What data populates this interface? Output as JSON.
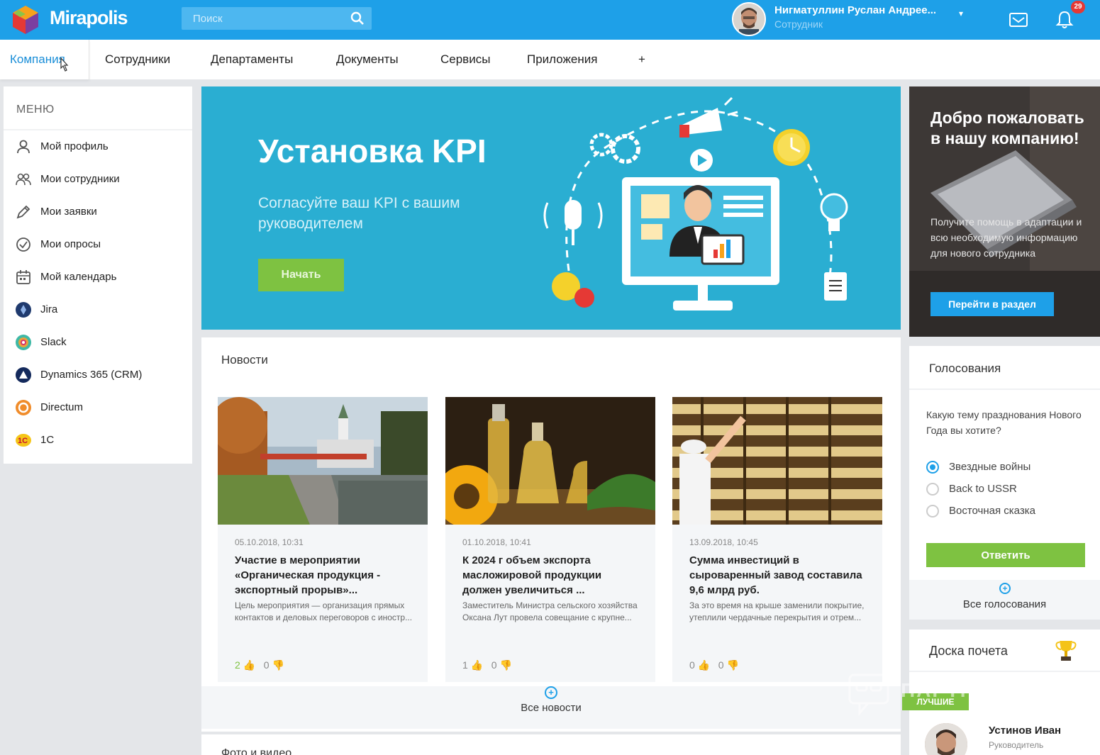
{
  "header": {
    "logo_text": "Mirapolis",
    "search_placeholder": "Поиск",
    "user_name": "Нигматуллин Руслан Андрее...",
    "user_role": "Сотрудник",
    "notifications_count": "29"
  },
  "nav": {
    "tabs": [
      "Компания",
      "Сотрудники",
      "Департаменты",
      "Документы",
      "Сервисы",
      "Приложения",
      "+"
    ],
    "active": "Компания"
  },
  "sidebar": {
    "title": "МЕНЮ",
    "items": [
      {
        "label": "Мой профиль",
        "icon": "user-icon"
      },
      {
        "label": "Мои сотрудники",
        "icon": "users-icon"
      },
      {
        "label": "Мои заявки",
        "icon": "pencil-icon"
      },
      {
        "label": "Мои опросы",
        "icon": "check-circle-icon"
      },
      {
        "label": "Мой календарь",
        "icon": "calendar-icon"
      },
      {
        "label": "Jira",
        "icon": "jira-icon"
      },
      {
        "label": "Slack",
        "icon": "slack-icon"
      },
      {
        "label": "Dynamics 365 (CRM)",
        "icon": "dynamics-icon"
      },
      {
        "label": "Directum",
        "icon": "directum-icon"
      },
      {
        "label": "1C",
        "icon": "1c-icon"
      }
    ]
  },
  "banner": {
    "title": "Установка KPI",
    "subtitle": "Согласуйте ваш KPI с вашим руководителем",
    "button": "Начать"
  },
  "welcome": {
    "title": "Добро пожаловать в нашу компанию!",
    "text": "Получите помощь в адаптации и всю необходимую информацию для нового сотрудника",
    "button": "Перейти в раздел"
  },
  "news": {
    "title": "Новости",
    "items": [
      {
        "date": "05.10.2018, 10:31",
        "headline": "Участие в мероприятии «Органическая продукция - экспортный прорыв»...",
        "text": "Цель мероприятия — организация прямых контактов и деловых переговоров с иностр...",
        "likes": "2",
        "dislikes": "0"
      },
      {
        "date": "01.10.2018, 10:41",
        "headline": "К 2024 г объем экспорта масложировой продукции должен увеличиться ...",
        "text": "Заместитель Министра сельского хозяйства Оксана Лут провела совещание с крупне...",
        "likes": "1",
        "dislikes": "0"
      },
      {
        "date": "13.09.2018, 10:45",
        "headline": "Сумма инвестиций в сыроваренный завод составила 9,6 млрд руб.",
        "text": "За это время на крыше заменили покрытие, утеплили чердачные перекрытия и отрем...",
        "likes": "0",
        "dislikes": "0"
      }
    ],
    "all_label": "Все новости"
  },
  "photo": {
    "title": "Фото и видео"
  },
  "polls": {
    "title": "Голосования",
    "question": "Какую тему празднования Нового Года вы хотите?",
    "options": [
      "Звездные войны",
      "Back to USSR",
      "Восточная сказка"
    ],
    "selected": 0,
    "button": "Ответить",
    "all_label": "Все голосования"
  },
  "honor": {
    "title": "Доска почета",
    "badge": "ЛУЧШИЕ",
    "person_name": "Устинов Иван",
    "person_role": "Руководитель"
  },
  "watermark": {
    "text": "ПАРТНЕРКИН"
  },
  "colors": {
    "accent": "#1ea0e8",
    "green": "#7ec241",
    "banner": "#2aaed2"
  }
}
